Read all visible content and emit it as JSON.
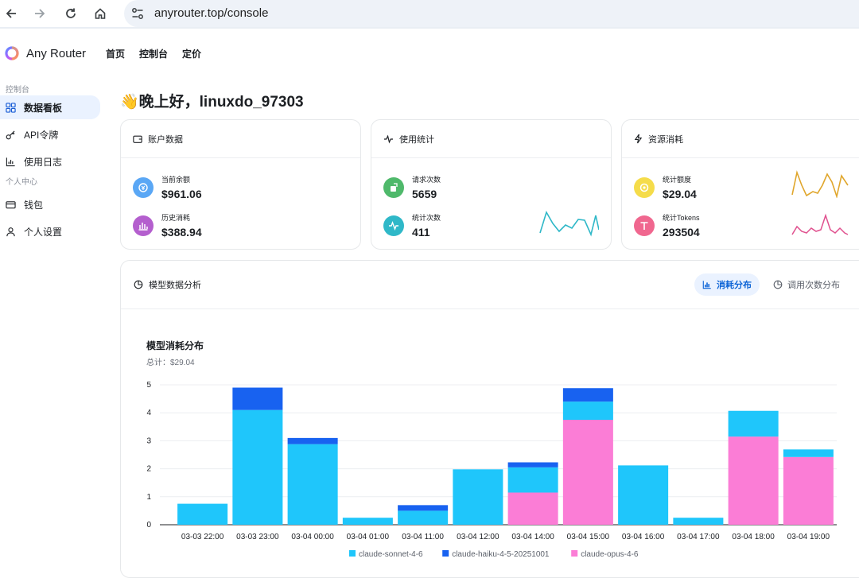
{
  "browser": {
    "url": "anyrouter.top/console"
  },
  "header": {
    "brand": "Any Router",
    "nav": [
      "首页",
      "控制台",
      "定价"
    ]
  },
  "sidebar": {
    "section_console": "控制台",
    "items_console": [
      {
        "label": "数据看板",
        "icon": "dashboard-icon",
        "active": true
      },
      {
        "label": "API令牌",
        "icon": "key-icon",
        "active": false
      },
      {
        "label": "使用日志",
        "icon": "chart-icon",
        "active": false
      }
    ],
    "section_personal": "个人中心",
    "items_personal": [
      {
        "label": "钱包",
        "icon": "wallet-icon"
      },
      {
        "label": "个人设置",
        "icon": "user-icon"
      }
    ]
  },
  "greeting": "👋晚上好，linuxdo_97303",
  "cards": {
    "account": {
      "title": "账户数据",
      "balance_label": "当前余额",
      "balance_value": "$961.06",
      "history_label": "历史消耗",
      "history_value": "$388.94"
    },
    "usage": {
      "title": "使用统计",
      "requests_label": "请求次数",
      "requests_value": "5659",
      "count_label": "统计次数",
      "count_value": "411"
    },
    "resource": {
      "title": "资源消耗",
      "quota_label": "统计额度",
      "quota_value": "$29.04",
      "tokens_label": "统计Tokens",
      "tokens_value": "293504"
    }
  },
  "analysis": {
    "title": "模型数据分析",
    "tab_active": "消耗分布",
    "tab_inactive": "调用次数分布"
  },
  "colors": {
    "sonnet": "#1fc6fb",
    "haiku": "#1862f0",
    "opus": "#fb7dd6"
  },
  "chart_data": {
    "type": "bar",
    "title": "模型消耗分布",
    "subtitle": "总计：$29.04",
    "categories": [
      "03-03 22:00",
      "03-03 23:00",
      "03-04 00:00",
      "03-04 01:00",
      "03-04 11:00",
      "03-04 12:00",
      "03-04 14:00",
      "03-04 15:00",
      "03-04 16:00",
      "03-04 17:00",
      "03-04 18:00",
      "03-04 19:00"
    ],
    "stacked": true,
    "series": [
      {
        "name": "claude-opus-4-6",
        "values": [
          0,
          0,
          0,
          0,
          0,
          0,
          1.15,
          3.75,
          0,
          0,
          3.15,
          2.42
        ]
      },
      {
        "name": "claude-sonnet-4-6",
        "values": [
          0.75,
          4.1,
          2.88,
          0.25,
          0.5,
          1.98,
          0.9,
          0.65,
          2.12,
          0.25,
          0.92,
          0.27
        ]
      },
      {
        "name": "claude-haiku-4-5-20251001",
        "values": [
          0,
          0.8,
          0.22,
          0,
          0.2,
          0,
          0.18,
          0.48,
          0,
          0,
          0,
          0
        ]
      }
    ],
    "legend_order": [
      "claude-sonnet-4-6",
      "claude-haiku-4-5-20251001",
      "claude-opus-4-6"
    ],
    "yticks": [
      0,
      1,
      2,
      3,
      4,
      5
    ],
    "ylim": [
      0,
      5
    ],
    "grid": true,
    "legend_position": "bottom"
  }
}
